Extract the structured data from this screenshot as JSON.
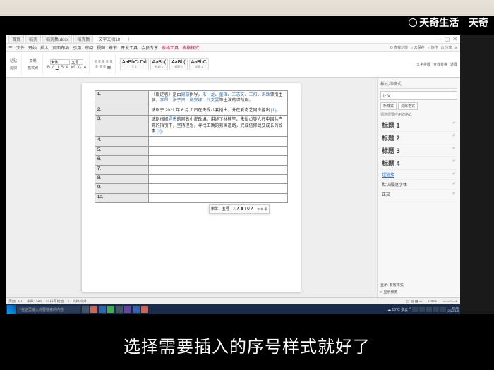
{
  "watermark": {
    "full": "天奇生活",
    "partial": "天奇"
  },
  "tabs": [
    {
      "label": "首页"
    },
    {
      "label": "稻壳"
    },
    {
      "label": "稻壳集.docx"
    },
    {
      "label": "稻壳集"
    },
    {
      "label": "文字文稿18",
      "active": true
    }
  ],
  "menu": [
    "三",
    "文件",
    "开始",
    "插入",
    "页面布局",
    "引用",
    "审阅",
    "视图",
    "章节",
    "开发工具",
    "会员专享",
    "表格工具",
    "表格样式"
  ],
  "menu_right": [
    "Q 查找功能",
    "○ 未保存",
    "♂ 协作",
    "⊡ 分享",
    "∧"
  ],
  "ribbon": {
    "paste": "粘贴",
    "cut": "剪切",
    "copy": "复制",
    "brush": "格式刷",
    "font_name": "宋体",
    "font_size": "五号",
    "styles": [
      {
        "preview": "AaBbCcDd",
        "name": "正文"
      },
      {
        "preview": "AaBb(",
        "name": "标题 1"
      },
      {
        "preview": "AaBb(",
        "name": "标题 2"
      },
      {
        "preview": "AaBbC",
        "name": "标题 3"
      }
    ],
    "right": [
      "文字排版",
      "查找替换",
      "选择"
    ]
  },
  "table_rows": [
    {
      "n": "1.",
      "c": "《叛逆者》是由<lk>周游</lk>执导，<lk>朱一龙</lk>、<lk>童瑶</lk>、<lk>王志文</lk>、<lk>王阳</lk>、<lk>朱珠</lk>领衔主演，<lk>李昂</lk>、<lk>张子贤</lk>、<lk>姚安娜</lk>、<lk>代文雯</lk>等主演的谍战剧。"
    },
    {
      "n": "2.",
      "c": "该剧于 2021 年 6 月 7 日在央视八套播出，并在爱奇艺同步播出 <brkt>[1]</brkt>。"
    },
    {
      "n": "3.",
      "c": "该剧根据<lk>畀愚</lk>的同名小说改编。讲述了林楠笙、朱怡贞等人在中国共产党的指引下，坚持理想，寻找正确的救国道路，完成信仰蜕变成长的故事 <brkt>[2]</brkt>。"
    },
    {
      "n": "4.",
      "c": ""
    },
    {
      "n": "5.",
      "c": ""
    },
    {
      "n": "6.",
      "c": ""
    },
    {
      "n": "7.",
      "c": ""
    },
    {
      "n": "8.",
      "c": ""
    },
    {
      "n": "9.",
      "c": ""
    },
    {
      "n": "10.",
      "c": ""
    }
  ],
  "float_tb": {
    "font": "宋体",
    "size": "五号",
    "items": [
      "A",
      "A",
      "B",
      "I",
      "U",
      "A",
      "⋮≡",
      "≡",
      "⊞"
    ]
  },
  "side": {
    "title": "样式和格式",
    "current": "正文",
    "btn1": "新样式",
    "btn2": "清除格式",
    "section": "请选择要应用的格式",
    "list": [
      {
        "label": "标题 1",
        "big": true
      },
      {
        "label": "标题 2",
        "big": true
      },
      {
        "label": "标题 3",
        "big": true
      },
      {
        "label": "标题 4",
        "big": true
      },
      {
        "label": "超链接",
        "link": true
      },
      {
        "label": "默认段落字体"
      },
      {
        "label": "正文"
      }
    ],
    "show_label": "显示: 有效样式",
    "footer": "□ 显示预览"
  },
  "status": {
    "left": [
      "页面: 1/1",
      "字数: 148",
      "☑ 拼写检查",
      "☐ 文档校对"
    ],
    "right": [
      "◫ ▤ ▦ ☰",
      "130%",
      "— ─○─ +"
    ]
  },
  "taskbar": {
    "search_placeholder": "在这里输入你要搜索的内容",
    "weather": "☁ 10°C 多云",
    "time": "10:45",
    "date": "2022/1/5"
  },
  "caption": "选择需要插入的序号样式就好了"
}
